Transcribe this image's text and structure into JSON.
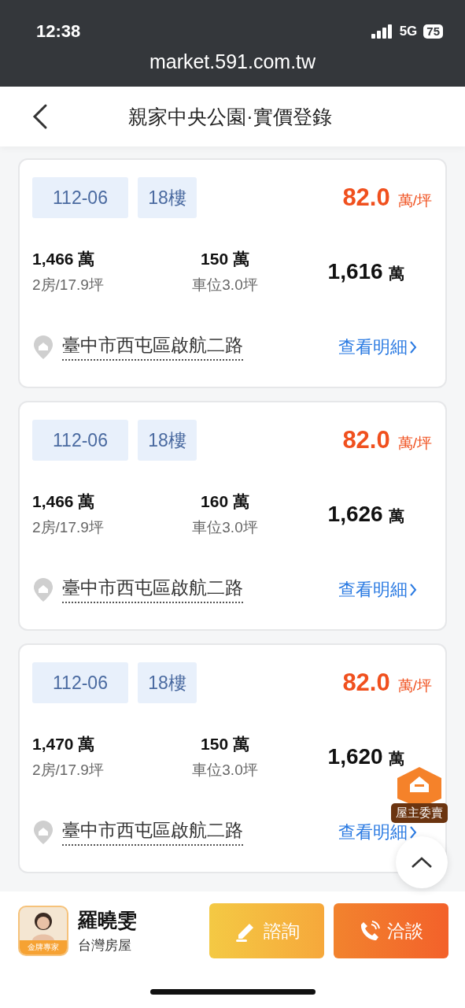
{
  "status_bar": {
    "time": "12:38",
    "network": "5G",
    "battery": "75"
  },
  "url": "market.591.com.tw",
  "header": {
    "title": "親家中央公園·實價登錄"
  },
  "records": [
    {
      "date": "112-06",
      "floor": "18樓",
      "unit_price": "82.0",
      "unit_price_unit": "萬/坪",
      "house_price": "1,466",
      "house_unit": "萬",
      "house_detail": "2房/17.9坪",
      "parking_price": "150",
      "parking_unit": "萬",
      "parking_detail": "車位3.0坪",
      "total_price": "1,616",
      "total_unit": "萬",
      "address": "臺中市西屯區啟航二路",
      "detail_link": "查看明細"
    },
    {
      "date": "112-06",
      "floor": "18樓",
      "unit_price": "82.0",
      "unit_price_unit": "萬/坪",
      "house_price": "1,466",
      "house_unit": "萬",
      "house_detail": "2房/17.9坪",
      "parking_price": "160",
      "parking_unit": "萬",
      "parking_detail": "車位3.0坪",
      "total_price": "1,626",
      "total_unit": "萬",
      "address": "臺中市西屯區啟航二路",
      "detail_link": "查看明細"
    },
    {
      "date": "112-06",
      "floor": "18樓",
      "unit_price": "82.0",
      "unit_price_unit": "萬/坪",
      "house_price": "1,470",
      "house_unit": "萬",
      "house_detail": "2房/17.9坪",
      "parking_price": "150",
      "parking_unit": "萬",
      "parking_detail": "車位3.0坪",
      "total_price": "1,620",
      "total_unit": "萬",
      "address": "臺中市西屯區啟航二路",
      "detail_link": "查看明細"
    }
  ],
  "owner_badge": {
    "label": "屋主委賣"
  },
  "agent": {
    "badge": "金牌專家",
    "name": "羅曉雯",
    "company": "台灣房屋"
  },
  "actions": [
    {
      "kind": "inquire",
      "label": "諮詢"
    },
    {
      "kind": "call",
      "label": "洽談"
    }
  ]
}
